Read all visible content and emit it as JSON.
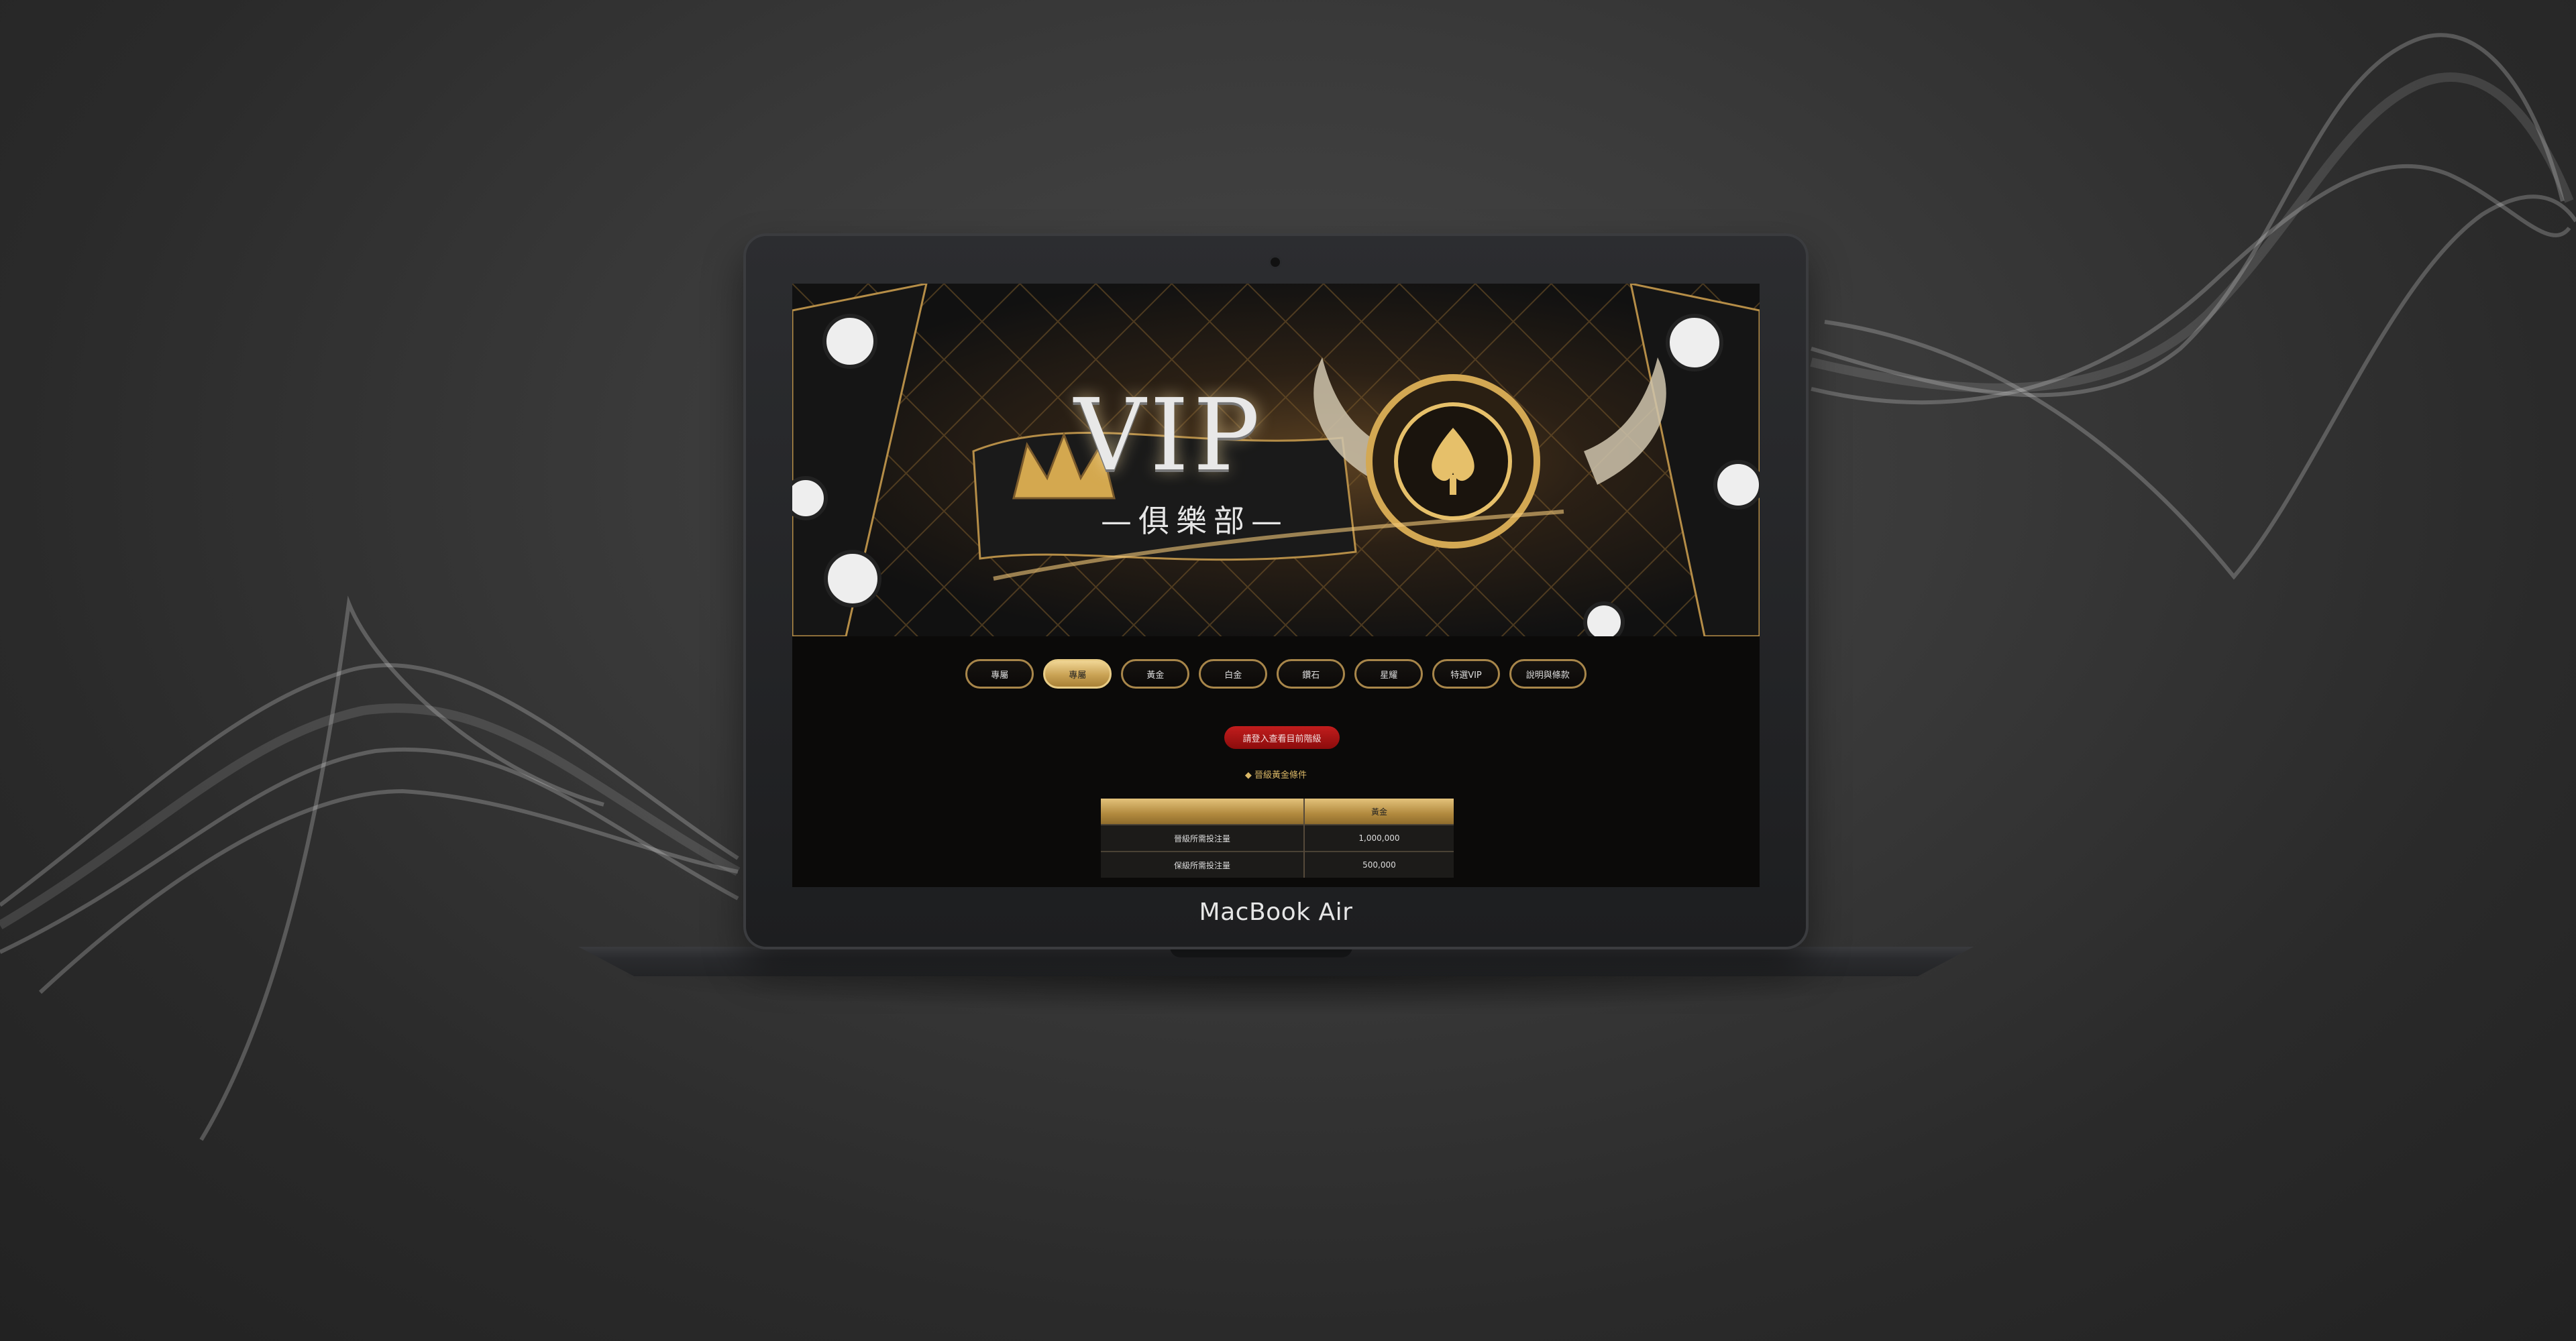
{
  "device": {
    "brand": "MacBook Air"
  },
  "banner": {
    "title": "VIP",
    "subtitle": "—俱樂部—"
  },
  "nav": {
    "tabs": [
      {
        "label": "專屬",
        "active": false
      },
      {
        "label": "專屬",
        "active": true
      },
      {
        "label": "黃金",
        "active": false
      },
      {
        "label": "白金",
        "active": false
      },
      {
        "label": "鑽石",
        "active": false
      },
      {
        "label": "星耀",
        "active": false
      },
      {
        "label": "特選VIP",
        "active": false
      },
      {
        "label": "說明與條款",
        "active": false
      }
    ]
  },
  "login_button": {
    "label": "請登入查看目前階級"
  },
  "upgrade_condition": {
    "label": "◆ 晉級黃金條件"
  },
  "table": {
    "header": {
      "col1": "",
      "col2": "黃金"
    },
    "rows": [
      {
        "label": "晉級所需投注量",
        "value": "1,000,000"
      },
      {
        "label": "保級所需投注量",
        "value": "500,000"
      }
    ]
  },
  "colors": {
    "gold": "#c9a254",
    "red": "#b01616",
    "background": "#3a3a3a"
  }
}
